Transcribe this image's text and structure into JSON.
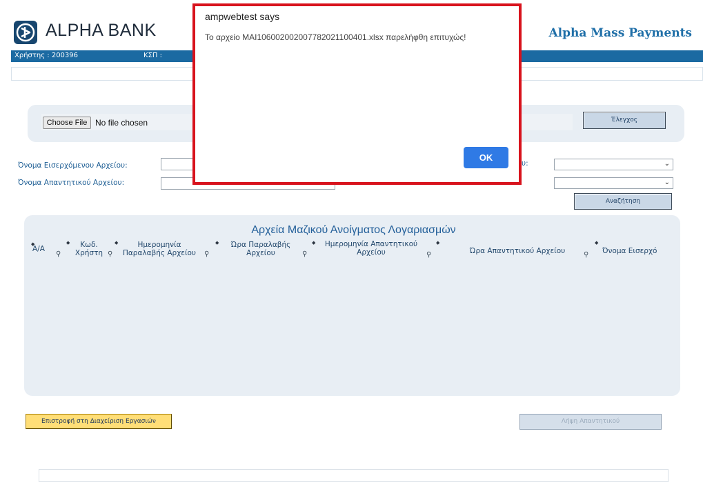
{
  "header": {
    "brand": "ALPHA BANK",
    "app_title": "Alpha Mass Payments",
    "user_label": "Χρήστης : 200396",
    "ksp_label": "ΚΣΠ :",
    "logo_icon": "alpha-bank-logo-icon"
  },
  "file_upload": {
    "choose_file_label": "Choose File",
    "no_file_text": "No file chosen",
    "check_button": "Έλεγχος"
  },
  "form": {
    "incoming_file_label": "Όνομα Εισερχόμενου Αρχείου:",
    "incoming_file_value": "",
    "response_file_label": "Όνομα Απαντητικού Αρχείου:",
    "response_file_value": "",
    "partial_label": "υ:",
    "select_1_value": "",
    "select_2_value": "",
    "search_button": "Αναζήτηση"
  },
  "results": {
    "title": "Αρχεία Μαζικού Ανοίγματος Λογαριασμών",
    "columns": [
      "Α/Α",
      "Κωδ. Χρήστη",
      "Ημερομηνία Παραλαβής Αρχείου",
      "Ώρα Παραλαβής Αρχείου",
      "Ημερομηνία Απαντητικού Αρχείου",
      "Ώρα Απαντητικού Αρχείου",
      "Όνομα Εισερχό"
    ],
    "rows": []
  },
  "actions": {
    "back_button": "Επιστροφή στη Διαχείριση Εργασιών",
    "receive_button": "Λήψη Απαντητικού"
  },
  "dialog": {
    "title": "ampwebtest says",
    "message": "Το αρχείο MAI106002002007782021100401.xlsx παρελήφθη επιτυχώς!",
    "ok_button": "OK"
  },
  "colors": {
    "brand_blue": "#1b6aa2",
    "dialog_border": "#d8131d",
    "ok_button": "#2f7ae5",
    "back_button": "#ffde77"
  }
}
